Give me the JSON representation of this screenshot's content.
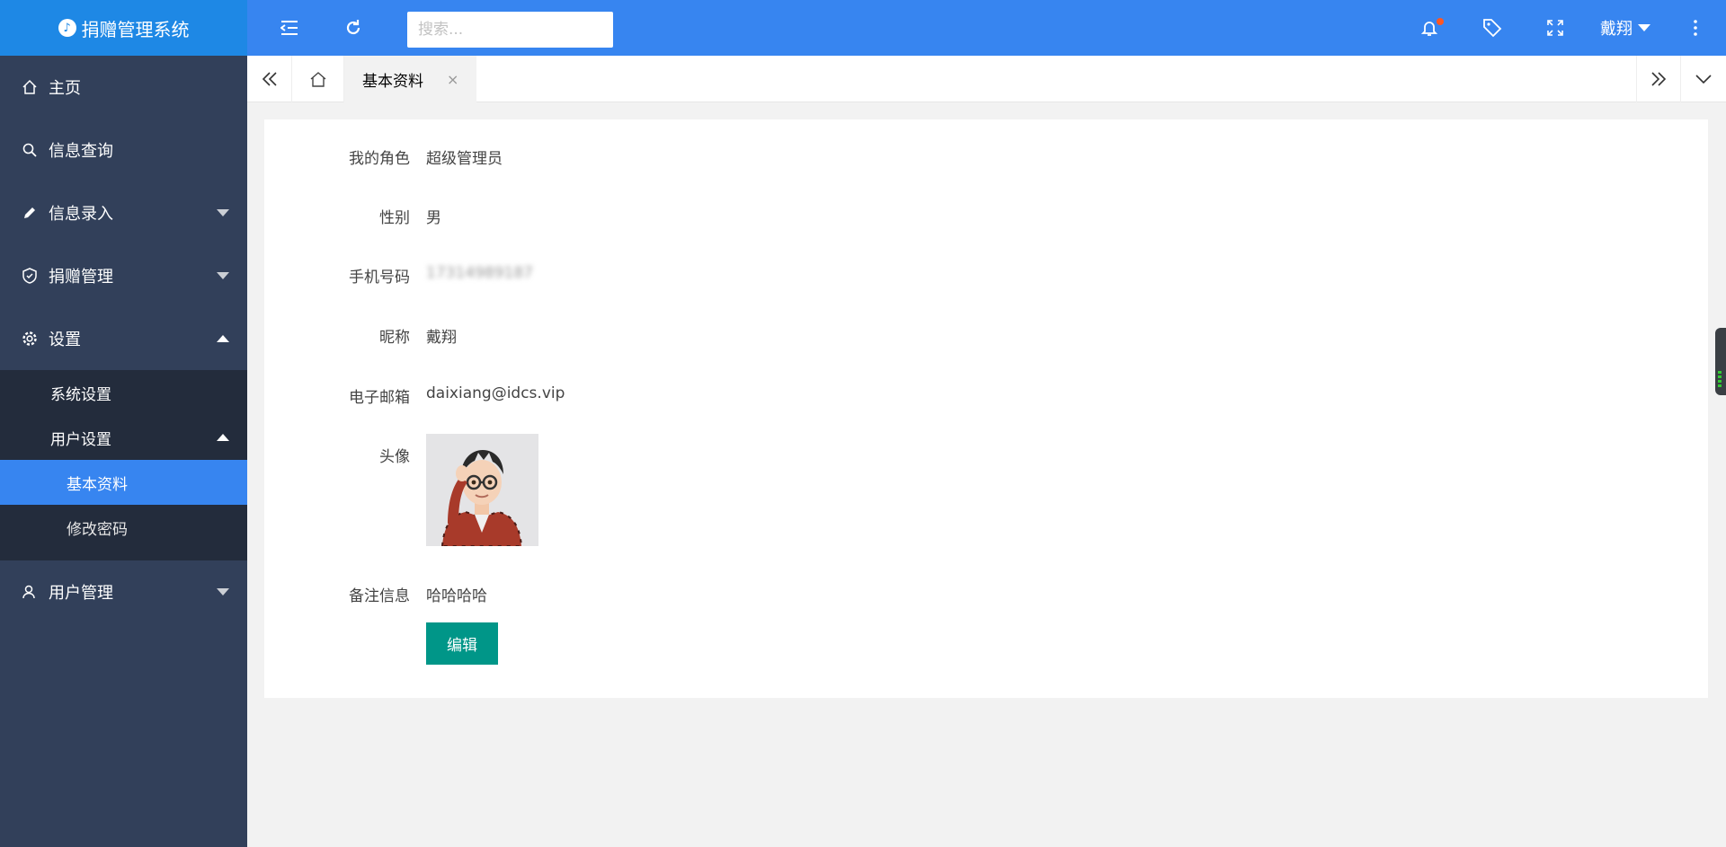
{
  "app": {
    "title": "捐赠管理系统"
  },
  "header": {
    "search_placeholder": "搜索...",
    "user_name": "戴翔",
    "icons": [
      "menu-collapse-icon",
      "refresh-icon",
      "bell-icon",
      "tag-icon",
      "fullscreen-icon",
      "more-vertical-icon"
    ],
    "notification_dot_color": "#ff5722",
    "accent": "#3785f0"
  },
  "sidebar": {
    "items": [
      {
        "label": "主页",
        "icon": "home-icon"
      },
      {
        "label": "信息查询",
        "icon": "search-icon"
      },
      {
        "label": "信息录入",
        "icon": "pencil-icon"
      },
      {
        "label": "捐赠管理",
        "icon": "shield-icon"
      },
      {
        "label": "设置",
        "icon": "gear-icon"
      },
      {
        "label": "用户管理",
        "icon": "user-icon"
      }
    ],
    "settings_sub": {
      "system": "系统设置",
      "user": "用户设置",
      "user_sub": [
        "基本资料",
        "修改密码"
      ]
    }
  },
  "tabs": {
    "active": "基本资料",
    "close": "×"
  },
  "profile": {
    "role_label": "我的角色",
    "role": "超级管理员",
    "gender_label": "性别",
    "gender": "男",
    "phone_label": "手机号码",
    "phone": "17314989187",
    "nickname_label": "昵称",
    "nickname": "戴翔",
    "email_label": "电子邮箱",
    "email": "daixiang@idcs.vip",
    "avatar_label": "头像",
    "note_label": "备注信息",
    "note": "哈哈哈哈",
    "edit_button": "编辑"
  }
}
